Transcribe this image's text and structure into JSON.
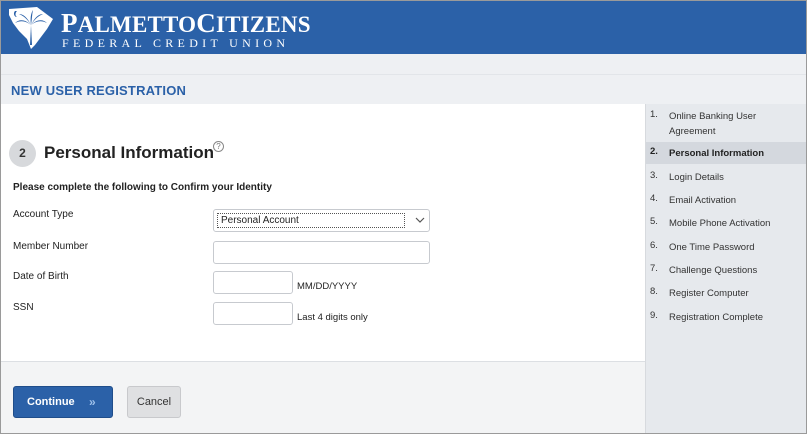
{
  "brand": {
    "name_first_initial": "P",
    "name_first_rest": "ALMETTO",
    "name_second_initial": "C",
    "name_second_rest": "ITIZENS",
    "subtitle": "FEDERAL CREDIT UNION",
    "colors": {
      "header": "#2b61a8",
      "title": "#2b61a8"
    }
  },
  "page": {
    "title": "NEW USER REGISTRATION"
  },
  "section": {
    "step": "2",
    "title": "Personal Information",
    "help_icon": "question-circle-icon",
    "help_glyph": "?",
    "instruction": "Please complete the following to Confirm your Identity"
  },
  "form": {
    "account_type": {
      "label": "Account Type",
      "value": "Personal Account"
    },
    "member_number": {
      "label": "Member Number",
      "value": ""
    },
    "dob": {
      "label": "Date of Birth",
      "value": "",
      "hint": "MM/DD/YYYY"
    },
    "ssn": {
      "label": "SSN",
      "value": "",
      "hint": "Last 4 digits only"
    }
  },
  "buttons": {
    "continue": "Continue",
    "continue_icon": "double-chevron-right-icon",
    "continue_glyph": "»",
    "cancel": "Cancel"
  },
  "sidebar": {
    "active_index": 1,
    "items": [
      {
        "num": "1.",
        "label": "Online Banking User Agreement"
      },
      {
        "num": "2.",
        "label": "Personal Information"
      },
      {
        "num": "3.",
        "label": "Login Details"
      },
      {
        "num": "4.",
        "label": "Email Activation"
      },
      {
        "num": "5.",
        "label": "Mobile Phone Activation"
      },
      {
        "num": "6.",
        "label": "One Time Password"
      },
      {
        "num": "7.",
        "label": "Challenge Questions"
      },
      {
        "num": "8.",
        "label": "Register Computer"
      },
      {
        "num": "9.",
        "label": "Registration Complete"
      }
    ]
  }
}
